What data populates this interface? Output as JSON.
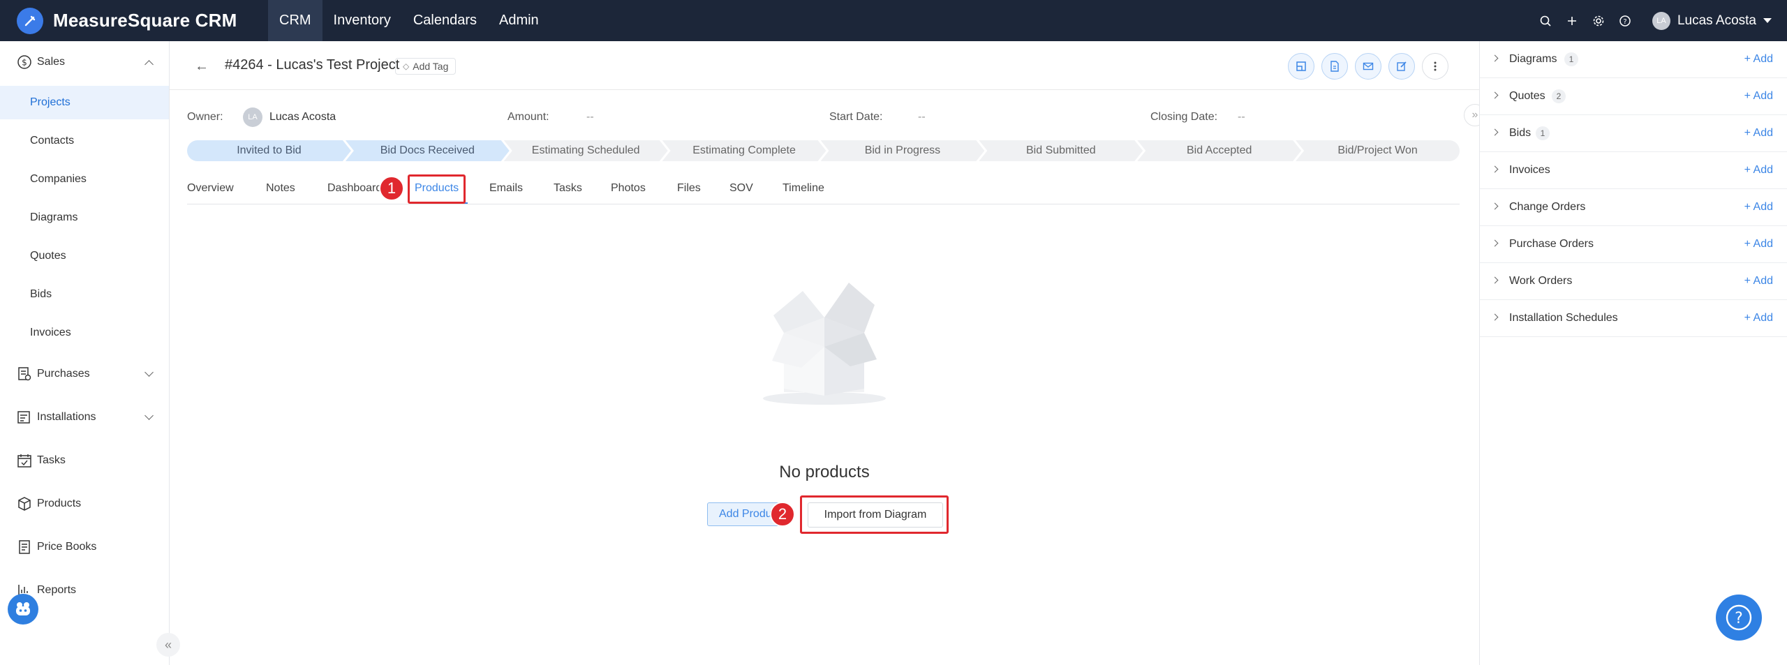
{
  "app": {
    "name": "MeasureSquare CRM"
  },
  "nav": {
    "items": [
      "CRM",
      "Inventory",
      "Calendars",
      "Admin"
    ]
  },
  "user": {
    "initials": "LA",
    "name": "Lucas Acosta"
  },
  "sidebar": {
    "sales": "Sales",
    "sales_items": [
      "Projects",
      "Contacts",
      "Companies",
      "Diagrams",
      "Quotes",
      "Bids",
      "Invoices"
    ],
    "purchases": "Purchases",
    "installations": "Installations",
    "tasks": "Tasks",
    "products": "Products",
    "price_books": "Price Books",
    "reports": "Reports"
  },
  "project": {
    "title": "#4264 - Lucas's Test Project",
    "add_tag": "Add Tag",
    "owner_label": "Owner:",
    "owner_initials": "LA",
    "owner_name": "Lucas Acosta",
    "amount_label": "Amount:",
    "amount_value": "--",
    "start_label": "Start Date:",
    "start_value": "--",
    "closing_label": "Closing Date:",
    "closing_value": "--"
  },
  "stages": [
    "Invited to Bid",
    "Bid Docs Received",
    "Estimating Scheduled",
    "Estimating Complete",
    "Bid in Progress",
    "Bid Submitted",
    "Bid Accepted",
    "Bid/Project Won"
  ],
  "tabs": [
    "Overview",
    "Notes",
    "Dashboard",
    "Products",
    "Emails",
    "Tasks",
    "Photos",
    "Files",
    "SOV",
    "Timeline"
  ],
  "empty": {
    "title": "No products",
    "add_button": "Add Product",
    "import_button": "Import from Diagram"
  },
  "annotations": {
    "step1": "1",
    "step2": "2"
  },
  "right_panel": {
    "add_label": "Add",
    "rows": [
      {
        "label": "Diagrams",
        "count": "1"
      },
      {
        "label": "Quotes",
        "count": "2"
      },
      {
        "label": "Bids",
        "count": "1"
      },
      {
        "label": "Invoices",
        "count": ""
      },
      {
        "label": "Change Orders",
        "count": ""
      },
      {
        "label": "Purchase Orders",
        "count": ""
      },
      {
        "label": "Work Orders",
        "count": ""
      },
      {
        "label": "Installation Schedules",
        "count": ""
      }
    ]
  },
  "colors": {
    "topbar": "#1c2639",
    "accent": "#3c86e6",
    "highlight": "#e0282e",
    "stage_done": "#d4e7fb"
  }
}
